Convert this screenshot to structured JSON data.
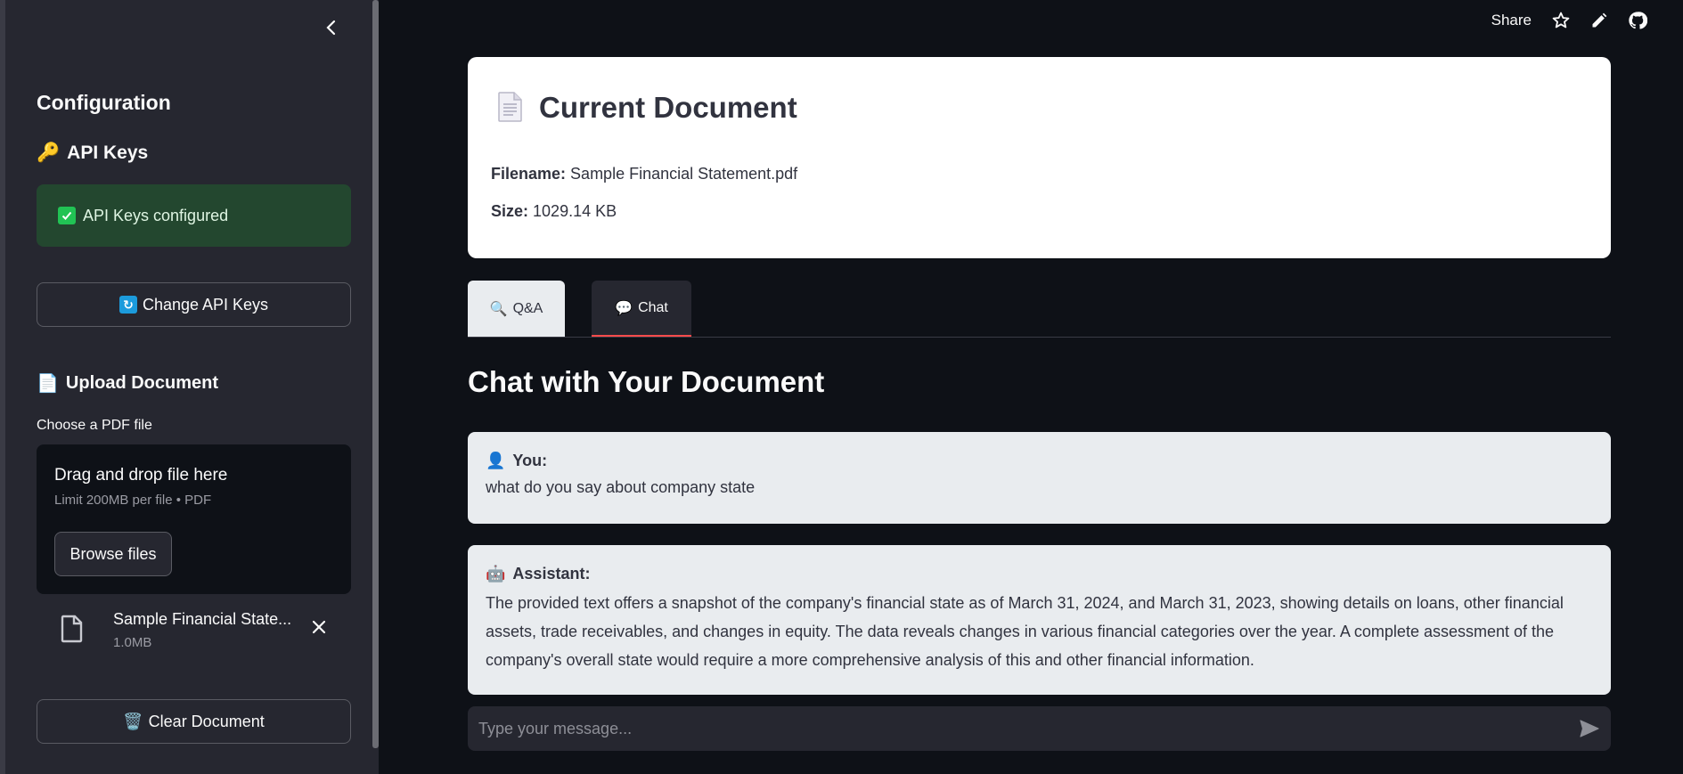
{
  "sidebar": {
    "config_title": "Configuration",
    "api_keys_title": "API Keys",
    "api_keys_emoji": "🔑",
    "success_text": "API Keys configured",
    "change_button": "Change API Keys",
    "upload_title": "Upload Document",
    "upload_emoji": "📄",
    "choose_label": "Choose a PDF file",
    "dropzone_title": "Drag and drop file here",
    "dropzone_sub": "Limit 200MB per file • PDF",
    "browse_button": "Browse files",
    "uploaded_file": {
      "name": "Sample Financial Statement.pdf",
      "display_name": "Sample Financial State...",
      "size": "1.0MB"
    },
    "clear_button": "Clear Document",
    "clear_emoji": "🗑️"
  },
  "toolbar": {
    "share_label": "Share"
  },
  "document": {
    "title": "Current Document",
    "filename_label": "Filename:",
    "filename": "Sample Financial Statement.pdf",
    "size_label": "Size:",
    "size": "1029.14 KB"
  },
  "tabs": [
    {
      "label": "Q&A",
      "emoji": "🔍"
    },
    {
      "label": "Chat",
      "emoji": "💬"
    }
  ],
  "chat": {
    "heading": "Chat with Your Document",
    "messages": [
      {
        "author": "You:",
        "emoji": "👤",
        "text": "what do you say about company state"
      },
      {
        "author": "Assistant:",
        "emoji": "🤖",
        "text": "The provided text offers a snapshot of the company's financial state as of March 31, 2024, and March 31, 2023, showing details on loans, other financial assets, trade receivables, and changes in equity. The data reveals changes in various financial categories over the year. A complete assessment of the company's overall state would require a more comprehensive analysis of this and other financial information."
      }
    ],
    "input_placeholder": "Type your message..."
  },
  "colors": {
    "accent": "#ff4b4b",
    "success_bg": "#23472f",
    "sidebar_bg": "#262730",
    "main_bg": "#0e1117"
  }
}
